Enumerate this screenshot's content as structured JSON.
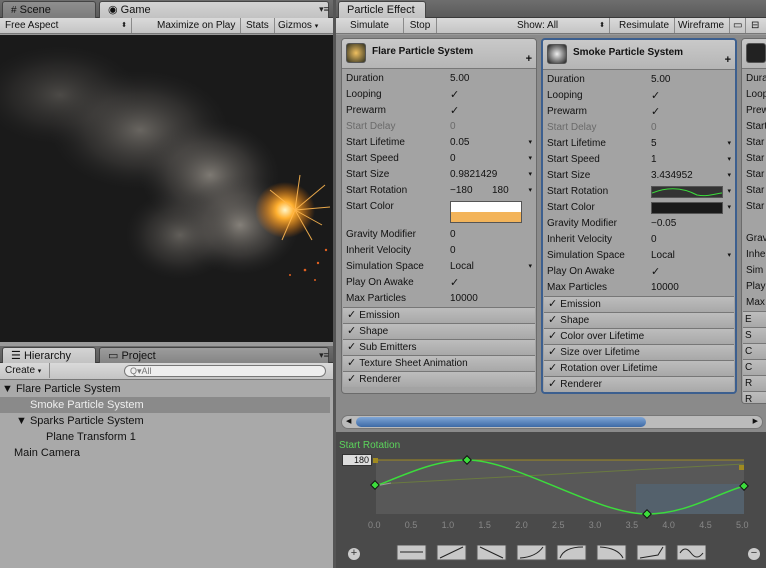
{
  "left_tabs": {
    "scene": "Scene",
    "game": "Game"
  },
  "game_toolbar": {
    "aspect": "Free Aspect",
    "maximize": "Maximize on Play",
    "stats": "Stats",
    "gizmos": "Gizmos"
  },
  "right_tab": "Particle Effect",
  "pe_toolbar": {
    "simulate": "Simulate",
    "stop": "Stop",
    "show": "Show: All",
    "resimulate": "Resimulate",
    "wireframe": "Wireframe"
  },
  "flare": {
    "title": "Flare Particle System",
    "rows": [
      {
        "label": "Duration",
        "value": "5.00"
      },
      {
        "label": "Looping",
        "check": "✓"
      },
      {
        "label": "Prewarm",
        "check": "✓"
      },
      {
        "label": "Start Delay",
        "value": "0",
        "disabled": true
      },
      {
        "label": "Start Lifetime",
        "value": "0.05",
        "arrow": "▾"
      },
      {
        "label": "Start Speed",
        "value": "0",
        "arrow": "▾"
      },
      {
        "label": "Start Size",
        "value": "0.9821429",
        "arrow": "▾"
      },
      {
        "label": "Start Rotation",
        "value": "−180",
        "value2": "180",
        "arrow": "▾"
      },
      {
        "label": "Start Color",
        "color": "gradient"
      },
      {
        "label": "Gravity Modifier",
        "value": "0"
      },
      {
        "label": "Inherit Velocity",
        "value": "0"
      },
      {
        "label": "Simulation Space",
        "value": "Local",
        "arrow": "▾"
      },
      {
        "label": "Play On Awake",
        "check": "✓"
      },
      {
        "label": "Max Particles",
        "value": "10000"
      }
    ],
    "modules": [
      "Emission",
      "Shape",
      "Sub Emitters",
      "Texture Sheet Animation",
      "Renderer"
    ]
  },
  "smoke": {
    "title": "Smoke Particle System",
    "rows": [
      {
        "label": "Duration",
        "value": "5.00"
      },
      {
        "label": "Looping",
        "check": "✓"
      },
      {
        "label": "Prewarm",
        "check": "✓"
      },
      {
        "label": "Start Delay",
        "value": "0",
        "disabled": true
      },
      {
        "label": "Start Lifetime",
        "value": "5",
        "arrow": "▾"
      },
      {
        "label": "Start Speed",
        "value": "1",
        "arrow": "▾"
      },
      {
        "label": "Start Size",
        "value": "3.434952",
        "arrow": "▾"
      },
      {
        "label": "Start Rotation",
        "color": "curve",
        "arrow": "▾"
      },
      {
        "label": "Start Color",
        "color": "dark",
        "arrow": "▾"
      },
      {
        "label": "Gravity Modifier",
        "value": "−0.05"
      },
      {
        "label": "Inherit Velocity",
        "value": "0"
      },
      {
        "label": "Simulation Space",
        "value": "Local",
        "arrow": "▾"
      },
      {
        "label": "Play On Awake",
        "check": "✓"
      },
      {
        "label": "Max Particles",
        "value": "10000"
      }
    ],
    "modules": [
      "Emission",
      "Shape",
      "Color over Lifetime",
      "Size over Lifetime",
      "Rotation over Lifetime",
      "Renderer"
    ]
  },
  "third": {
    "rows": [
      "Dura",
      "Loop",
      "Prew",
      "Start",
      "Star",
      "Star",
      "Star",
      "Star",
      "Star",
      "",
      "Grav",
      "Inhe",
      "Sim",
      "Play",
      "Max"
    ],
    "modules": [
      "E",
      "S",
      "C",
      "C",
      "R",
      "R"
    ]
  },
  "curve": {
    "title": "Start Rotation",
    "value_box": "180",
    "ticks": [
      "0.0",
      "0.5",
      "1.0",
      "1.5",
      "2.0",
      "2.5",
      "3.0",
      "3.5",
      "4.0",
      "4.5",
      "5.0"
    ]
  },
  "hierarchy": {
    "tab": "Hierarchy",
    "project_tab": "Project",
    "create": "Create",
    "search_placeholder": "Q▾All",
    "items": [
      "Flare Particle System",
      "Smoke Particle System",
      "Sparks Particle System",
      "Plane Transform 1",
      "Main Camera"
    ]
  },
  "colors": {
    "selection": "#3c5f8f",
    "curve_green": "#3cdc3c",
    "curve_bg": "#4a4a4a"
  }
}
